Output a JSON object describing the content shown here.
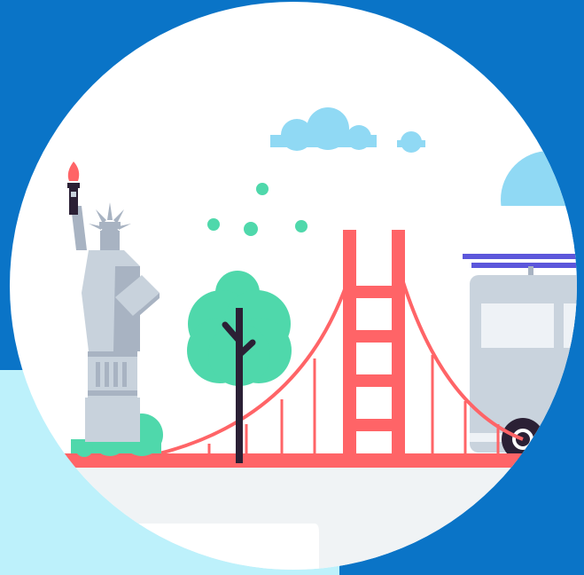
{
  "scene": {
    "subject": "city-landmarks-illustration",
    "colors": {
      "background_blue": "#0a74c7",
      "light_cyan": "#bdf1fb",
      "white": "#ffffff",
      "sky_cloud": "#90d9f4",
      "bridge_red": "#ff6467",
      "tree_green": "#4fd8ab",
      "trunk_dark": "#2b2035",
      "statue_grey_light": "#c8d2dc",
      "statue_grey_mid": "#a8b3c2",
      "statue_grey_dark": "#8e9aaa",
      "flame": "#ff6467",
      "ground": "#f0f3f5",
      "tram_body": "#c9d3dd",
      "tram_window": "#eef2f6",
      "tram_roof": "#5c57db",
      "wheel_dark": "#2b2035"
    },
    "icons": [
      "statue-of-liberty-icon",
      "tree-icon",
      "suspension-bridge-icon",
      "cable-car-icon",
      "cloud-icon"
    ]
  }
}
